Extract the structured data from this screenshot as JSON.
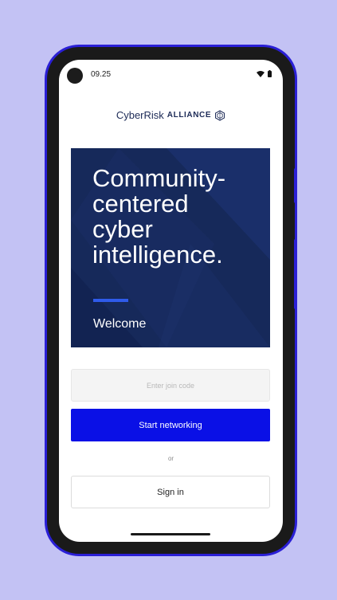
{
  "status_bar": {
    "time": "09.25",
    "icons": [
      "wifi-icon",
      "battery-icon"
    ]
  },
  "brand": {
    "name_main": "CyberRisk",
    "name_suffix": "ALLIANCE",
    "emblem_icon": "shield-emblem-icon",
    "color": "#1d2b57"
  },
  "hero": {
    "headline": "Community-\ncentered\ncyber\nintelligence.",
    "subtitle": "Welcome",
    "background": "#16295a",
    "accent": "#2f5bea"
  },
  "join": {
    "placeholder": "Enter join code",
    "value": ""
  },
  "actions": {
    "start_label": "Start networking",
    "start_color": "#0a10e6",
    "or_label": "or",
    "signin_label": "Sign in"
  },
  "colors": {
    "page_background": "#c3c2f4",
    "device_accent": "#2a1fd6"
  }
}
